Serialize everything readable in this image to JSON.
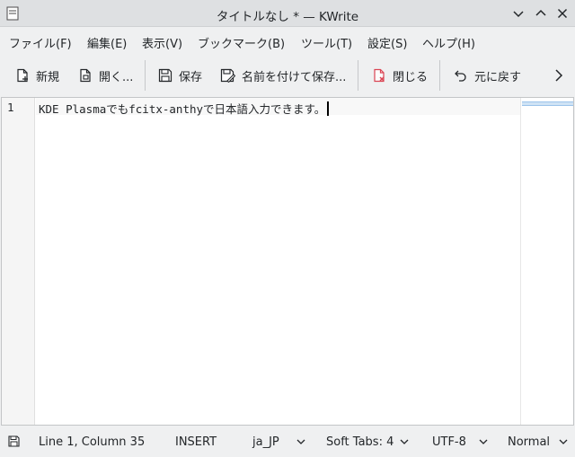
{
  "window": {
    "title": "タイトルなし * — KWrite"
  },
  "menu": {
    "items": [
      {
        "label": "ファイル(F)"
      },
      {
        "label": "編集(E)"
      },
      {
        "label": "表示(V)"
      },
      {
        "label": "ブックマーク(B)"
      },
      {
        "label": "ツール(T)"
      },
      {
        "label": "設定(S)"
      },
      {
        "label": "ヘルプ(H)"
      }
    ]
  },
  "toolbar": {
    "new_label": "新規",
    "open_label": "開く...",
    "save_label": "保存",
    "save_as_label": "名前を付けて保存...",
    "close_label": "閉じる",
    "undo_label": "元に戻す",
    "more_icon": "chevron-right-icon"
  },
  "editor": {
    "line_numbers": [
      "1"
    ],
    "lines": [
      "KDE Plasmaでもfcitx-anthyで日本語入力できます。"
    ]
  },
  "statusbar": {
    "save_icon": "save-icon",
    "cursor_position": "Line 1, Column 35",
    "input_mode": "INSERT",
    "dictionary": "ja_JP",
    "indentation": "Soft Tabs: 4",
    "encoding": "UTF-8",
    "mode": "Normal"
  },
  "colors": {
    "titlebar_bg": "#dee0e2",
    "window_bg": "#eff0f1",
    "editor_bg": "#ffffff",
    "close_icon_accent": "#da4453"
  }
}
